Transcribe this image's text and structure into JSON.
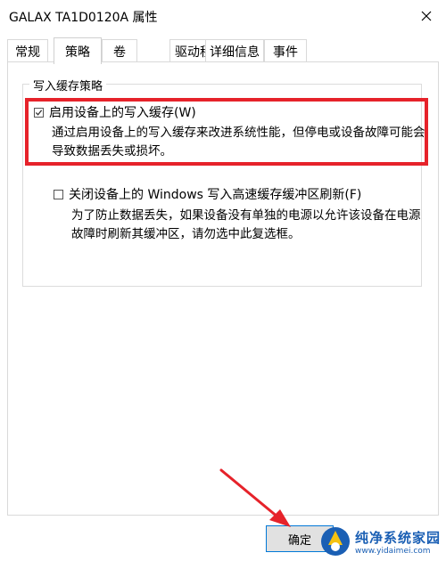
{
  "window": {
    "title": "GALAX TA1D0120A 属性"
  },
  "tabs": [
    {
      "label": "常规"
    },
    {
      "label": "策略"
    },
    {
      "label": "卷"
    },
    {
      "label": "驱动程序"
    },
    {
      "label": "详细信息"
    },
    {
      "label": "事件"
    }
  ],
  "active_tab": "策略",
  "policy": {
    "group_title": "写入缓存策略",
    "option1": {
      "label": "启用设备上的写入缓存(W)",
      "checked": true,
      "description_line1": "通过启用设备上的写入缓存来改进系统性能，但停电或设备故障可能会",
      "description_line2": "导致数据丢失或损坏。"
    },
    "option2": {
      "label": "关闭设备上的 Windows 写入高速缓存缓冲区刷新(F)",
      "checked": false,
      "description_line1": "为了防止数据丢失，如果设备没有单独的电源以允许该设备在电源",
      "description_line2": "故障时刷新其缓冲区，请勿选中此复选框。"
    }
  },
  "buttons": {
    "ok_label": "确定"
  },
  "watermark": {
    "name": "纯净系统家园",
    "url": "www.yidaimei.com"
  },
  "colors": {
    "highlight": "#e6222a",
    "accent": "#0078d7"
  }
}
